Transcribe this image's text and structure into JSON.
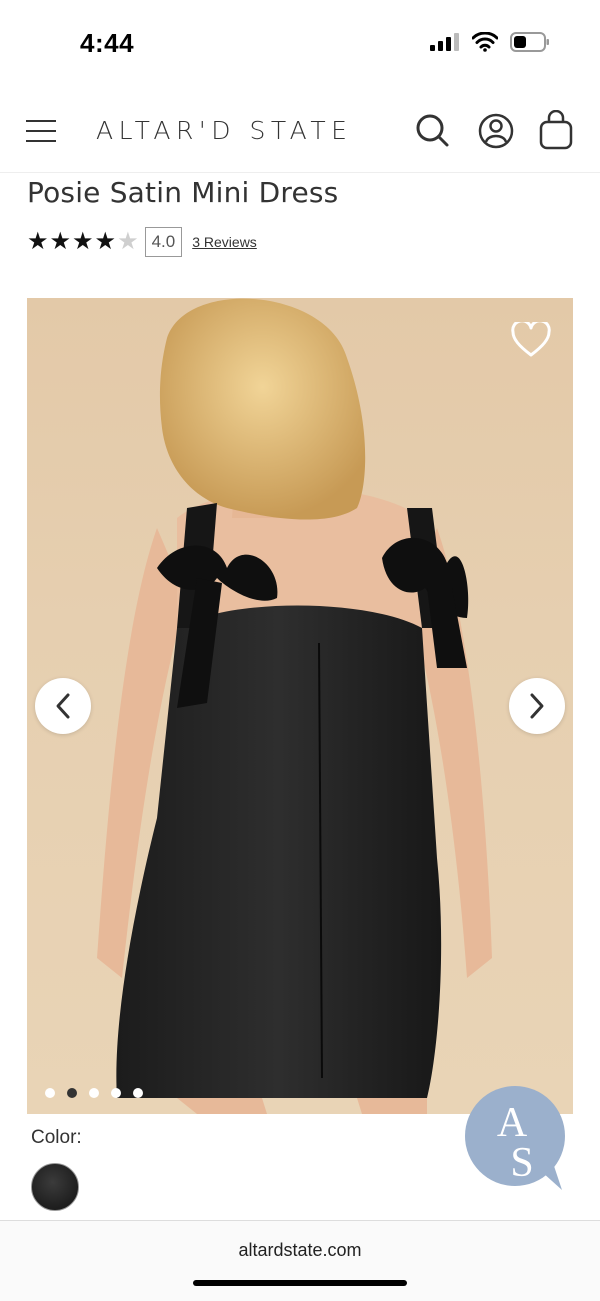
{
  "status_bar": {
    "time": "4:44"
  },
  "header": {
    "brand": "ALTAR'D STATE",
    "icons": [
      "menu-icon",
      "search-icon",
      "account-icon",
      "bag-icon"
    ]
  },
  "product": {
    "title": "Posie Satin Mini Dress",
    "rating": 4.0,
    "rating_text": "4.0",
    "reviews_text": "3 Reviews",
    "stars": [
      "★",
      "★",
      "★",
      "★",
      "★"
    ],
    "image": {
      "active_index": 1,
      "total_images": 5
    }
  },
  "color": {
    "label": "Color:",
    "swatch_color": "#222222"
  },
  "chat_badge": {
    "letters": "AS",
    "color": "#9bb0cc"
  },
  "browser": {
    "url": "altardstate.com"
  }
}
